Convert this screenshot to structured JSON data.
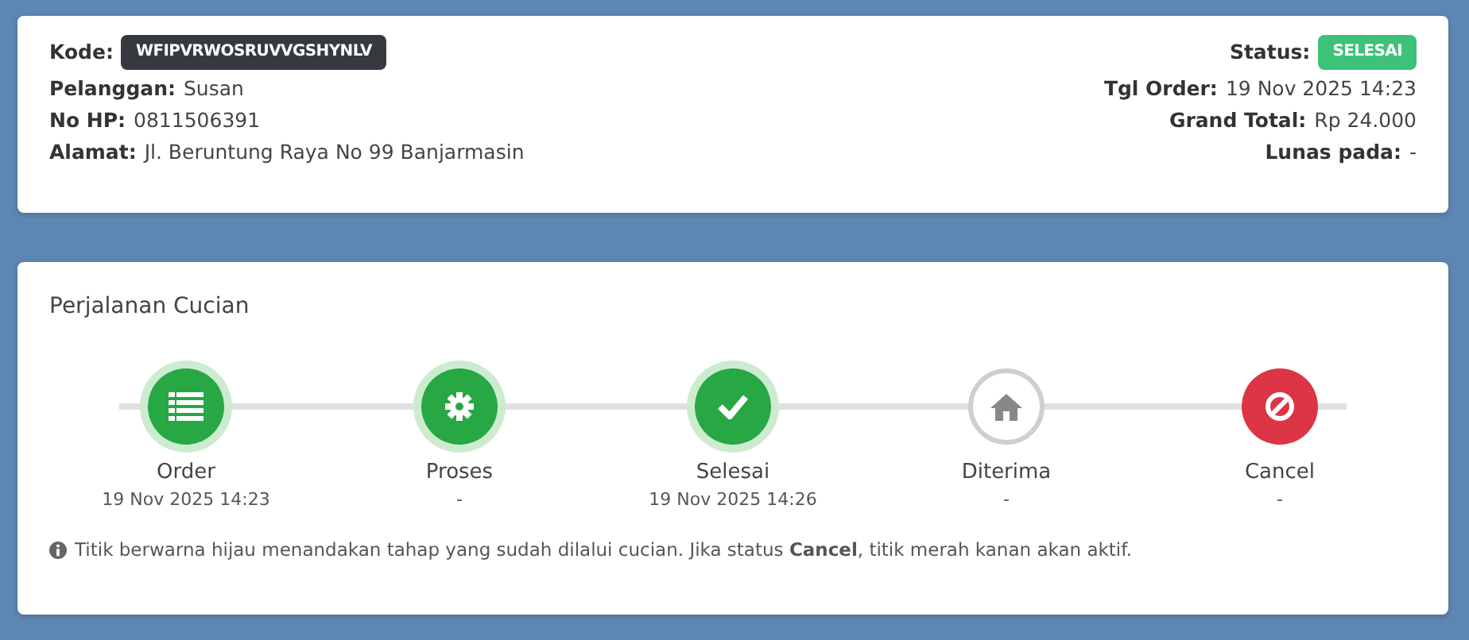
{
  "order": {
    "left": [
      {
        "label": "Kode:",
        "kind": "badge",
        "value": "WFIPVRWOSRUVVGSHYNLV"
      },
      {
        "label": "Pelanggan:",
        "kind": "text",
        "value": "Susan"
      },
      {
        "label": "No HP:",
        "kind": "text",
        "value": "0811506391"
      },
      {
        "label": "Alamat:",
        "kind": "text",
        "value": "Jl. Beruntung Raya No 99 Banjarmasin"
      }
    ],
    "right": [
      {
        "label": "Status:",
        "kind": "status",
        "value": "SELESAI"
      },
      {
        "label": "Tgl Order:",
        "kind": "text",
        "value": "19 Nov 2025 14:23"
      },
      {
        "label": "Grand Total:",
        "kind": "text",
        "value": "Rp 24.000"
      },
      {
        "label": "Lunas pada:",
        "kind": "text",
        "value": "-"
      }
    ]
  },
  "progress": {
    "title": "Perjalanan Cucian",
    "steps": [
      {
        "label": "Order",
        "time": "19 Nov 2025 14:23",
        "kind": "done"
      },
      {
        "label": "Proses",
        "time": "-",
        "kind": "done"
      },
      {
        "label": "Selesai",
        "time": "19 Nov 2025 14:26",
        "kind": "done"
      },
      {
        "label": "Diterima",
        "time": "-",
        "kind": "pending"
      },
      {
        "label": "Cancel",
        "time": "-",
        "kind": "cancel"
      }
    ],
    "note": "Titik berwarna hijau menandakan tahap yang sudah dilalui cucian. Jika status **Cancel**, titik merah kanan akan aktif."
  }
}
